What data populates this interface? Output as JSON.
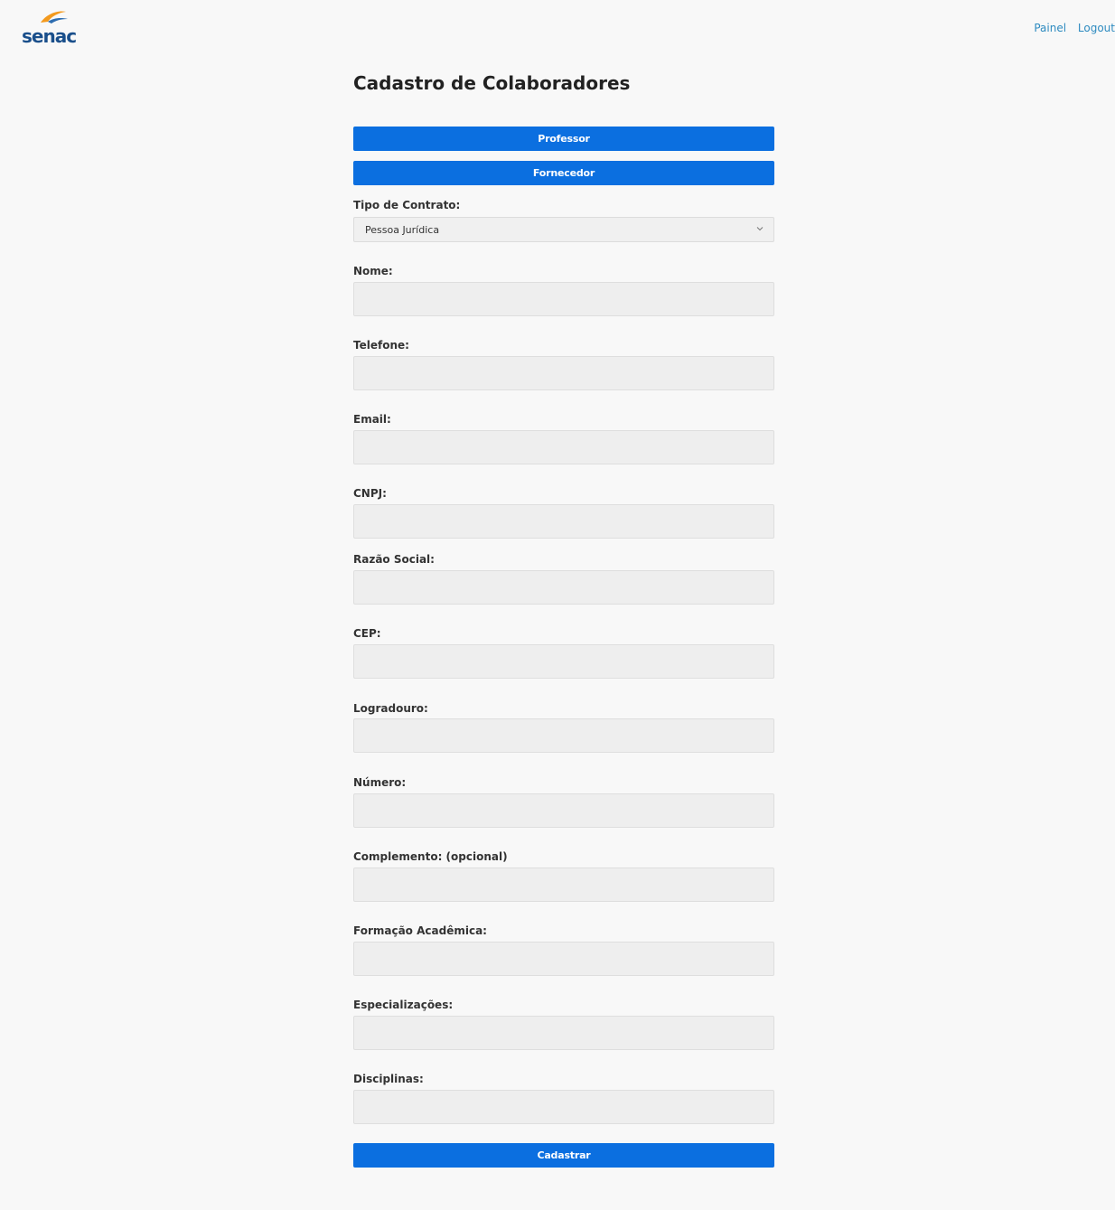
{
  "header": {
    "logo_text": "senac",
    "nav": {
      "painel": "Painel",
      "logout": "Logout"
    }
  },
  "form": {
    "title": "Cadastro de Colaboradores",
    "professor_button": "Professor",
    "fornecedor_button": "Fornecedor",
    "tipo_contrato": {
      "label": "Tipo de Contrato:",
      "value": "Pessoa Jurídica"
    },
    "fields": {
      "nome": {
        "label": "Nome:",
        "value": ""
      },
      "telefone": {
        "label": "Telefone:",
        "value": ""
      },
      "email": {
        "label": "Email:",
        "value": ""
      },
      "cnpj": {
        "label": "CNPJ:",
        "value": ""
      },
      "razao_social": {
        "label": "Razão Social:",
        "value": ""
      },
      "cep": {
        "label": "CEP:",
        "value": ""
      },
      "logradouro": {
        "label": "Logradouro:",
        "value": ""
      },
      "numero": {
        "label": "Número:",
        "value": ""
      },
      "complemento": {
        "label": "Complemento: (opcional)",
        "value": ""
      },
      "formacao": {
        "label": "Formação Acadêmica:",
        "value": ""
      },
      "especializacoes": {
        "label": "Especializações:",
        "value": ""
      },
      "disciplinas": {
        "label": "Disciplinas:",
        "value": ""
      }
    },
    "submit_button": "Cadastrar"
  },
  "colors": {
    "primary": "#0b6fe0",
    "link": "#2e8bc0",
    "logo_blue": "#1a4f8b",
    "logo_orange": "#f39a1e"
  }
}
